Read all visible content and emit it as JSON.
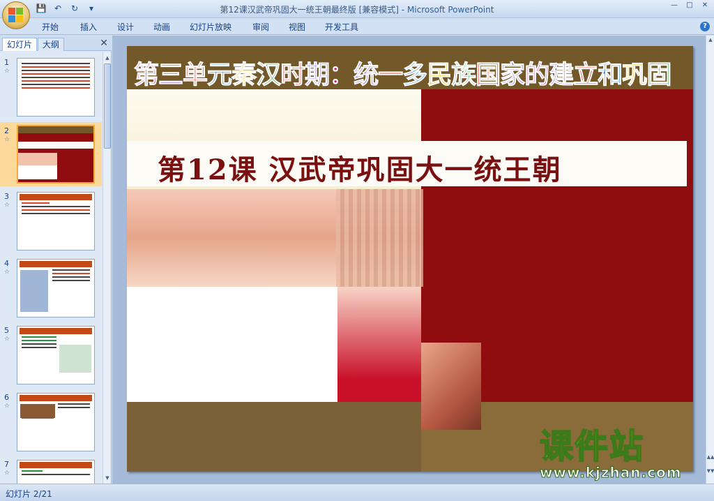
{
  "window": {
    "title": "第12课汉武帝巩固大一统王朝最终版 [兼容模式]",
    "app_name": " - Microsoft PowerPoint"
  },
  "quick_access": {
    "icons": [
      "save-icon",
      "undo-icon",
      "redo-icon",
      "customize-icon"
    ]
  },
  "ribbon": {
    "tabs": [
      "开始",
      "插入",
      "设计",
      "动画",
      "幻灯片放映",
      "审阅",
      "视图",
      "开发工具"
    ]
  },
  "left_panel": {
    "tabs": {
      "slides": "幻灯片",
      "outline": "大纲"
    },
    "thumbnails": [
      {
        "number": "1",
        "star": "☆"
      },
      {
        "number": "2",
        "star": "☆"
      },
      {
        "number": "3",
        "star": "☆"
      },
      {
        "number": "4",
        "star": "☆"
      },
      {
        "number": "5",
        "star": "☆"
      },
      {
        "number": "6",
        "star": "☆"
      },
      {
        "number": "7",
        "star": "☆"
      }
    ],
    "selected_index": 2
  },
  "slide": {
    "unit_title": "第三单元秦汉时期：统一多民族国家的建立和巩固",
    "lesson_title": "第12课 汉武帝巩固大一统王朝",
    "title_colors": [
      "#d4177b",
      "#7a3fd2",
      "#e8261b",
      "#2b8bd9",
      "#f2c40f",
      "#2a9d3a",
      "#e8261b",
      "#6a3bd1"
    ]
  },
  "watermark": {
    "brand": "课件站",
    "url": "www.kjzhan.com"
  },
  "status_bar": {
    "slide_counter": "幻灯片 2/21"
  }
}
